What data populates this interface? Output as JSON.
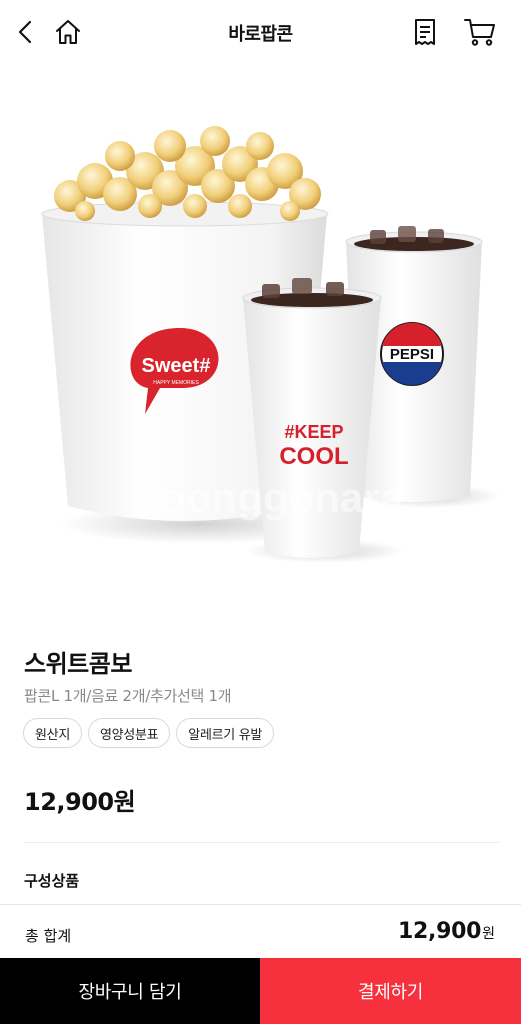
{
  "header": {
    "title": "바로팝콘",
    "icons": {
      "back": "chevron-left-icon",
      "home": "home-icon",
      "receipt": "receipt-icon",
      "cart": "cart-icon"
    }
  },
  "hero": {
    "popcorn_bucket_label": "Sweet#",
    "popcorn_bucket_sublabel": "HAPPY MEMORIES",
    "small_cup_label_line1": "#KEEP",
    "small_cup_label_line2": "COOL",
    "large_cup_label": "PEPSI",
    "watermark": "Joonggonara"
  },
  "product": {
    "name": "스위트콤보",
    "description": "팝콘L 1개/음료 2개/추가선택 1개",
    "chips": [
      "원산지",
      "영양성분표",
      "알레르기 유발"
    ],
    "price": "12,900원"
  },
  "composition": {
    "title": "구성상품"
  },
  "total": {
    "label": "총 합계",
    "amount": "12,900",
    "unit": "원"
  },
  "actions": {
    "add_to_cart": "장바구니 담기",
    "pay": "결제하기"
  },
  "colors": {
    "accent": "#f6303d",
    "dark_button": "#000000",
    "sweet_badge": "#d9232d",
    "pepsi_blue": "#1a3d8f",
    "pepsi_red": "#d6202c"
  }
}
